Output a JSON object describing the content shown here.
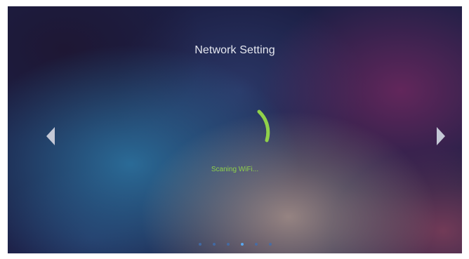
{
  "screen": {
    "title": "Network Setting",
    "status_text": "Scaning WiFi...",
    "spinner_icon": "loading-spinner-icon",
    "prev_icon": "chevron-left-icon",
    "next_icon": "chevron-right-icon"
  },
  "pager": {
    "total": 6,
    "active_index": 3
  },
  "colors": {
    "accent": "#8fd14a",
    "title": "#e6e8f0",
    "dot": "#3f6fb0",
    "dot_active": "#5aa8f0",
    "arrow": "#c4c8d6"
  }
}
